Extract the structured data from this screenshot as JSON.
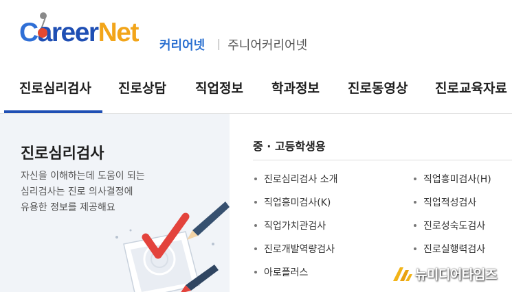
{
  "header": {
    "logo_text": "CareerNet",
    "sub_links": {
      "active": "커리어넷",
      "other": "주니어커리어넷"
    }
  },
  "nav": {
    "items": [
      "진로심리검사",
      "진로상담",
      "직업정보",
      "학과정보",
      "진로동영상",
      "진로교육자료"
    ],
    "active_index": 0
  },
  "left_panel": {
    "title": "진로심리검사",
    "desc_lines": [
      "자신을 이해하는데 도움이 되는",
      "심리검사는 진로 의사결정에",
      "유용한 정보를 제공해요"
    ]
  },
  "right_panel": {
    "group_title": "중 · 고등학생용",
    "left_column": [
      "진로심리검사 소개",
      "직업흥미검사(K)",
      "직업가치관검사",
      "진로개발역량검사",
      "아로플러스"
    ],
    "right_column": [
      "직업흥미검사(H)",
      "직업적성검사",
      "진로성숙도검사",
      "진로실행력검사"
    ]
  },
  "watermark": {
    "text": "뉴미디어타임즈"
  },
  "colors": {
    "brand_blue": "#1f4fb4",
    "brand_orange": "#f2a51a",
    "active_link": "#2a6fd0",
    "panel_bg": "#f1f4f8"
  }
}
